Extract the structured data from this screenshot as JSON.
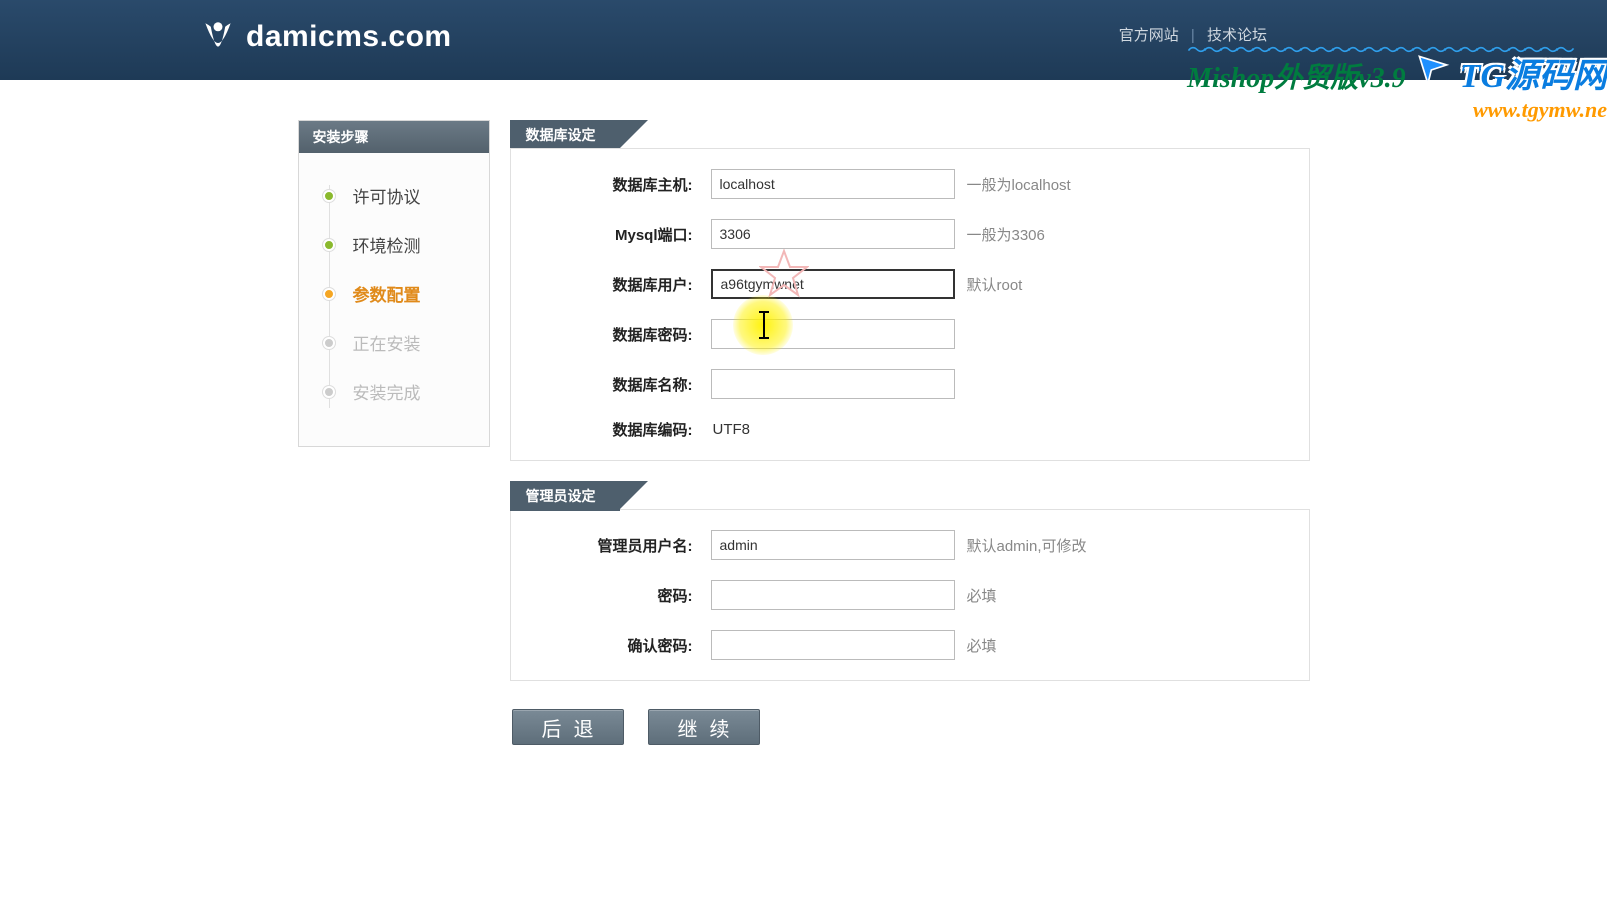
{
  "header": {
    "brand": "damicms.com",
    "links": {
      "official": "官方网站",
      "forum": "技术论坛"
    }
  },
  "overlay": {
    "mishop": "Mishop外贸版v3.9",
    "tg": "TG源码网",
    "url": "www.tgymw.ne"
  },
  "sidebar": {
    "title": "安装步骤",
    "steps": [
      {
        "label": "许可协议",
        "state": "done"
      },
      {
        "label": "环境检测",
        "state": "done"
      },
      {
        "label": "参数配置",
        "state": "active"
      },
      {
        "label": "正在安装",
        "state": "pending"
      },
      {
        "label": "安装完成",
        "state": "pending"
      }
    ]
  },
  "db": {
    "title": "数据库设定",
    "rows": {
      "host": {
        "label": "数据库主机:",
        "value": "localhost",
        "hint": "一般为localhost"
      },
      "port": {
        "label": "Mysql端口:",
        "value": "3306",
        "hint": "一般为3306"
      },
      "user": {
        "label": "数据库用户:",
        "value": "a96tgymwnet",
        "hint": "默认root"
      },
      "pass": {
        "label": "数据库密码:",
        "value": "",
        "hint": ""
      },
      "name": {
        "label": "数据库名称:",
        "value": "",
        "hint": ""
      },
      "charset": {
        "label": "数据库编码:",
        "value": "UTF8"
      }
    }
  },
  "admin": {
    "title": "管理员设定",
    "rows": {
      "user": {
        "label": "管理员用户名:",
        "value": "admin",
        "hint": "默认admin,可修改"
      },
      "pass": {
        "label": "密码:",
        "value": "",
        "hint": "必填"
      },
      "confirm": {
        "label": "确认密码:",
        "value": "",
        "hint": "必填"
      }
    }
  },
  "buttons": {
    "back": "后退",
    "continue": "继续"
  }
}
